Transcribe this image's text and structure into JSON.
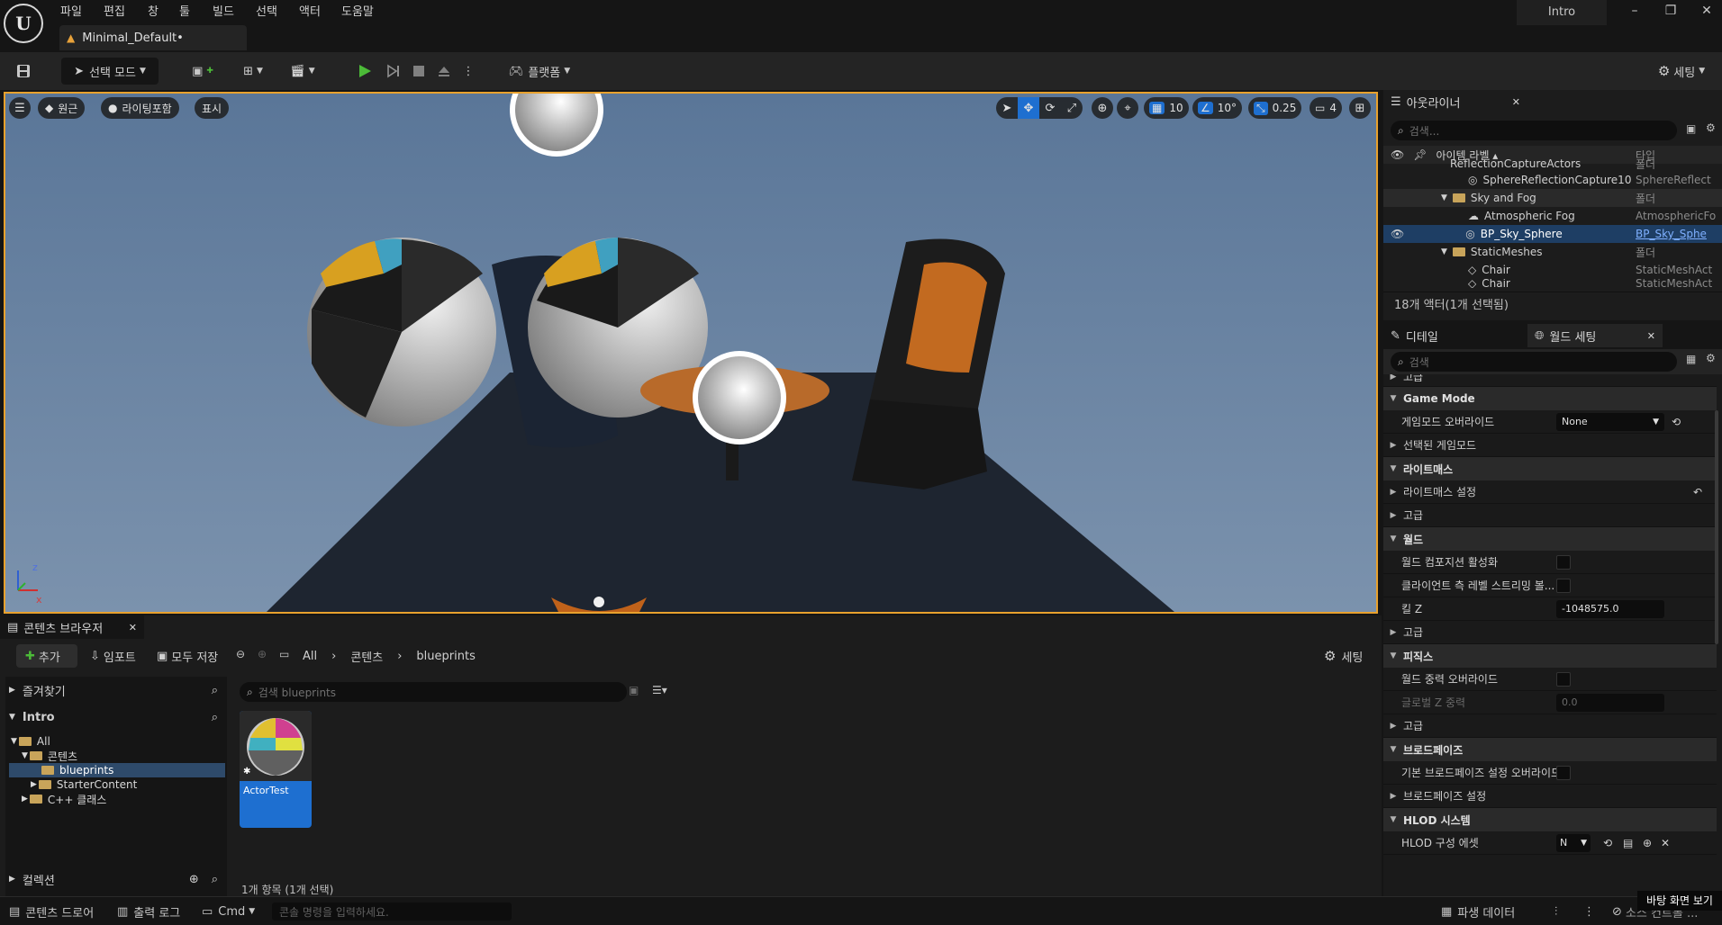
{
  "menu": {
    "items": [
      "파일",
      "편집",
      "창",
      "툴",
      "빌드",
      "선택",
      "액터",
      "도움말"
    ],
    "logo": "U",
    "project_name": "Intro",
    "doc_tab": "Minimal_Default•",
    "window_controls": [
      "–",
      "❐",
      "✕"
    ]
  },
  "toolbar": {
    "select_mode": "선택 모드",
    "platform": "플랫폼",
    "settings": "세팅"
  },
  "viewport": {
    "buttons": {
      "perspective": "원근",
      "lighting": "라이팅포함",
      "show": "표시"
    },
    "grid_snap": "10",
    "rotation_snap": "10°",
    "scale_snap": "0.25",
    "camera_speed": "4",
    "axis": {
      "z": "z",
      "x": "x"
    }
  },
  "outliner": {
    "tab_label": "아웃라이너",
    "search_placeholder": "검색...",
    "col_label": "아이템 라벨 ▴",
    "col_type": "타입",
    "rows": [
      {
        "label": "ReflectionCaptureActors",
        "type": "폴더"
      },
      {
        "label": "SphereReflectionCapture10",
        "type": "SphereReflect"
      },
      {
        "label": "Sky and Fog",
        "type": "폴더"
      },
      {
        "label": "Atmospheric Fog",
        "type": "AtmosphericFo"
      },
      {
        "label": "BP_Sky_Sphere",
        "type": "BP_Sky_Sphe"
      },
      {
        "label": "StaticMeshes",
        "type": "폴더"
      },
      {
        "label": "Chair",
        "type": "StaticMeshAct"
      },
      {
        "label": "Chair",
        "type": "StaticMeshAct"
      }
    ],
    "status": "18개 액터(1개 선택됨)"
  },
  "details": {
    "tab_details": "디테일",
    "tab_world": "월드 세팅",
    "search_placeholder": "검색",
    "rows": [
      {
        "kind": "prop",
        "label": "고급"
      },
      {
        "kind": "cat",
        "label": "Game Mode"
      },
      {
        "kind": "prop",
        "label": "게임모드 오버라이드",
        "value": "None"
      },
      {
        "kind": "sub",
        "label": "선택된 게임모드"
      },
      {
        "kind": "cat",
        "label": "라이트매스"
      },
      {
        "kind": "sub",
        "label": "라이트매스 설정"
      },
      {
        "kind": "sub",
        "label": "고급"
      },
      {
        "kind": "cat",
        "label": "월드"
      },
      {
        "kind": "prop",
        "label": "월드 컴포지션 활성화"
      },
      {
        "kind": "prop",
        "label": "클라이언트 측 레벨 스트리밍 볼..."
      },
      {
        "kind": "prop",
        "label": "킬 Z",
        "value": "-1048575.0"
      },
      {
        "kind": "sub",
        "label": "고급"
      },
      {
        "kind": "cat",
        "label": "피직스"
      },
      {
        "kind": "prop",
        "label": "월드 중력 오버라이드"
      },
      {
        "kind": "prop",
        "label": "글로벌 Z 중력",
        "value": "0.0"
      },
      {
        "kind": "sub",
        "label": "고급"
      },
      {
        "kind": "cat",
        "label": "브로드페이즈"
      },
      {
        "kind": "prop",
        "label": "기본 브로드페이즈 설정 오버라이드"
      },
      {
        "kind": "sub",
        "label": "브로드페이즈 설정"
      },
      {
        "kind": "cat",
        "label": "HLOD 시스템"
      },
      {
        "kind": "prop",
        "label": "HLOD 구성 에셋",
        "value": "N"
      }
    ]
  },
  "content_browser": {
    "tab_label": "콘텐츠 브라우저",
    "add": "추가",
    "import": "임포트",
    "save_all": "모두 저장",
    "breadcrumb": [
      "All",
      "콘텐츠",
      "blueprints"
    ],
    "settings": "세팅",
    "favorites": "즐겨찾기",
    "project": "Intro",
    "tree": [
      "All",
      "콘텐츠",
      "blueprints",
      "StarterContent",
      "C++ 클래스"
    ],
    "collections": "컬렉션",
    "search_placeholder": "검색 blueprints",
    "asset_name": "ActorTest",
    "item_count": "1개 항목 (1개 선택)"
  },
  "statusbar": {
    "content_drawer": "콘텐츠 드로어",
    "output_log": "출력 로그",
    "cmd": "Cmd",
    "console_placeholder": "콘솔 명령을 입력하세요.",
    "derived_data": "파생 데이터",
    "source_control": "소스 컨트롤 ...",
    "tooltip": "바탕 화면 보기"
  },
  "colors": {
    "accent_orange": "#e8a12d",
    "selection_blue": "#1e6fd0",
    "play_green": "#4cbb38"
  }
}
